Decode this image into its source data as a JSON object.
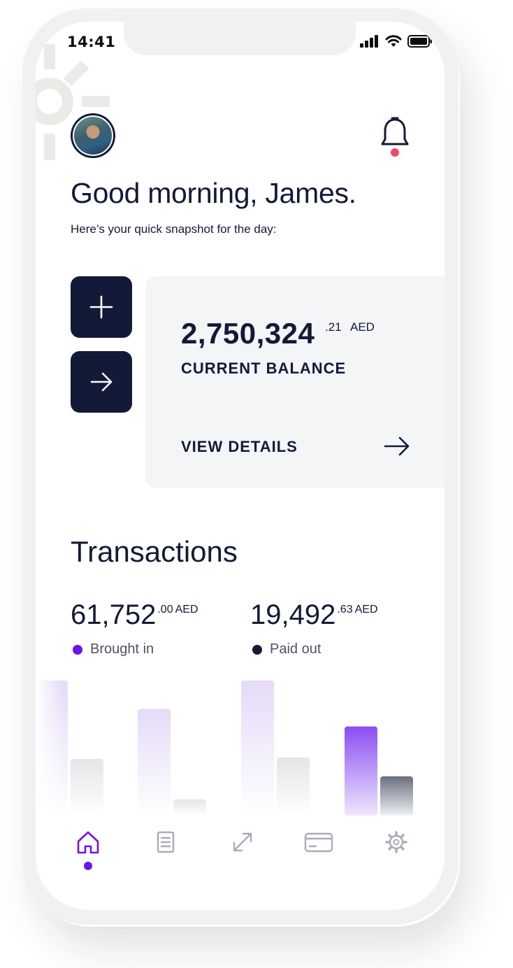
{
  "status_bar": {
    "time": "14:41"
  },
  "greeting": {
    "title": "Good morning, James.",
    "subtitle": "Here’s your quick snapshot for the day:"
  },
  "balance": {
    "amount": "2,750,324",
    "cents": ".21",
    "currency": "AED",
    "label": "CURRENT BALANCE",
    "view_details": "VIEW DETAILS"
  },
  "transactions": {
    "title": "Transactions",
    "brought_in": {
      "amount": "61,752",
      "cents": ".00",
      "currency": "AED",
      "label": "Brought in"
    },
    "paid_out": {
      "amount": "19,492",
      "cents": ".63",
      "currency": "AED",
      "label": "Paid out"
    }
  },
  "colors": {
    "primary": "#131a38",
    "accent": "#6f12f0",
    "brought_in": "#6f12f0",
    "paid_out": "#131a38",
    "notification": "#f04a6a",
    "card_bg": "#f4f5f7"
  },
  "chart_data": {
    "type": "bar",
    "categories": [
      "",
      "",
      "",
      ""
    ],
    "series": [
      {
        "name": "Brought in",
        "values": [
          100,
          79,
          100,
          66
        ]
      },
      {
        "name": "Paid out",
        "values": [
          42,
          12,
          43,
          29
        ]
      }
    ],
    "highlighted_index": 3
  },
  "nav": {
    "items": [
      {
        "icon": "home-icon",
        "active": true
      },
      {
        "icon": "document-icon",
        "active": false
      },
      {
        "icon": "transfer-icon",
        "active": false
      },
      {
        "icon": "card-icon",
        "active": false
      },
      {
        "icon": "settings-icon",
        "active": false
      }
    ]
  }
}
